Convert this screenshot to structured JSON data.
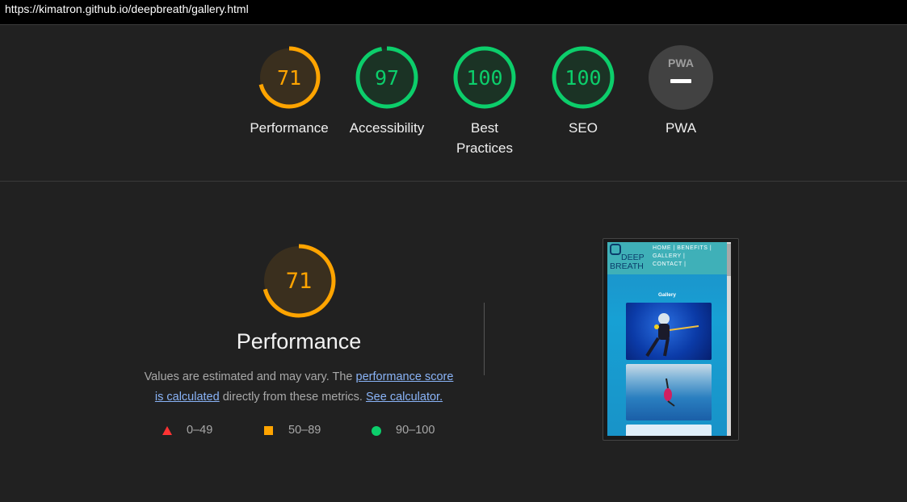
{
  "url": "https://kimatron.github.io/deepbreath/gallery.html",
  "colors": {
    "average": "#ffa400",
    "pass": "#0cce6b",
    "fail": "#ff3333",
    "pwa_bg": "#424242"
  },
  "categories": [
    {
      "id": "performance",
      "label": "Performance",
      "score": "71",
      "status": "average"
    },
    {
      "id": "accessibility",
      "label": "Accessibility",
      "score": "97",
      "status": "pass"
    },
    {
      "id": "best-practices",
      "label": "Best Practices",
      "label_line1": "Best",
      "label_line2": "Practices",
      "score": "100",
      "status": "pass"
    },
    {
      "id": "seo",
      "label": "SEO",
      "score": "100",
      "status": "pass"
    },
    {
      "id": "pwa",
      "label": "PWA",
      "badge_text": "PWA",
      "status": "na"
    }
  ],
  "performance_section": {
    "score": "71",
    "title": "Performance",
    "desc_part1": "Values are estimated and may vary. The ",
    "link_score": "performance score",
    "link_score_line2": "is calculated",
    "desc_part2": " directly from these metrics. ",
    "link_calculator": "See calculator."
  },
  "legend": {
    "fail": "0–49",
    "average": "50–89",
    "pass": "90–100"
  },
  "screenshot": {
    "logo_line1": "DEEP",
    "logo_line2": "BREATH",
    "nav_line1": "HOME | BENEFITS |",
    "nav_line2": "GALLERY |",
    "nav_line3": "CONTACT |",
    "page_title": "Gallery"
  }
}
